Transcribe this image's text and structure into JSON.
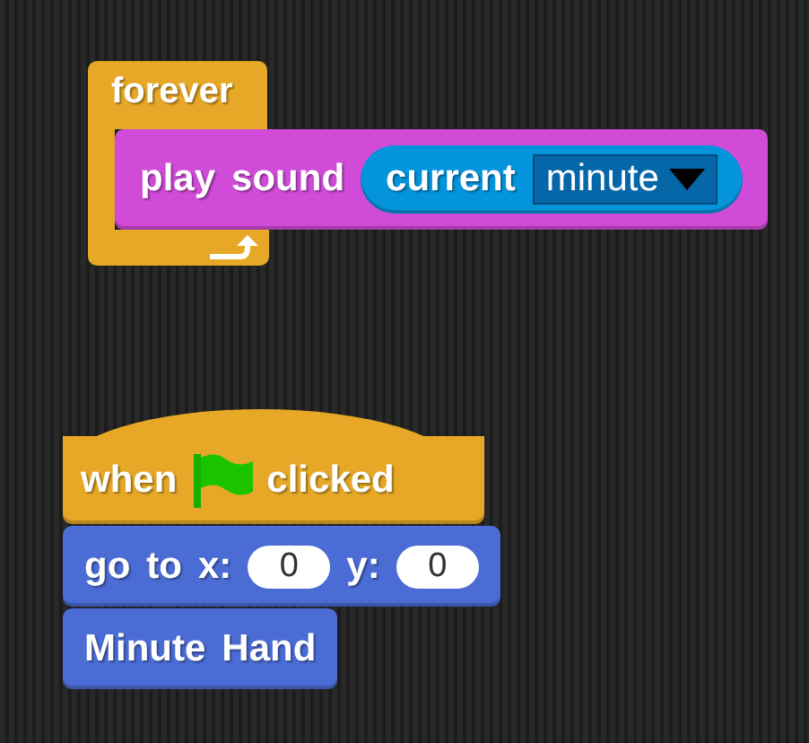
{
  "scripts": [
    {
      "kind": "forever",
      "label": "forever",
      "color": "#e6a826",
      "body": [
        {
          "kind": "command",
          "color": "#cf4bd8",
          "parts": [
            {
              "kind": "label",
              "text": "play"
            },
            {
              "kind": "label",
              "text": "sound"
            },
            {
              "kind": "reporter",
              "color": "#0494dc",
              "parts": [
                {
                  "kind": "label",
                  "text": "current"
                },
                {
                  "kind": "dropdown",
                  "text": "minute"
                }
              ]
            }
          ]
        }
      ]
    },
    {
      "kind": "hat",
      "color": "#e6a826",
      "parts": [
        {
          "kind": "label",
          "text": "when"
        },
        {
          "kind": "flag"
        },
        {
          "kind": "label",
          "text": "clicked"
        }
      ],
      "next": [
        {
          "kind": "command",
          "color": "#4a6cd4",
          "parts": [
            {
              "kind": "label",
              "text": "go"
            },
            {
              "kind": "label",
              "text": "to"
            },
            {
              "kind": "label",
              "text": "x:"
            },
            {
              "kind": "number",
              "text": "0"
            },
            {
              "kind": "label",
              "text": "y:"
            },
            {
              "kind": "number",
              "text": "0"
            }
          ]
        },
        {
          "kind": "command",
          "color": "#4a6cd4",
          "parts": [
            {
              "kind": "label",
              "text": "Minute"
            },
            {
              "kind": "label",
              "text": "Hand"
            }
          ]
        }
      ]
    }
  ]
}
